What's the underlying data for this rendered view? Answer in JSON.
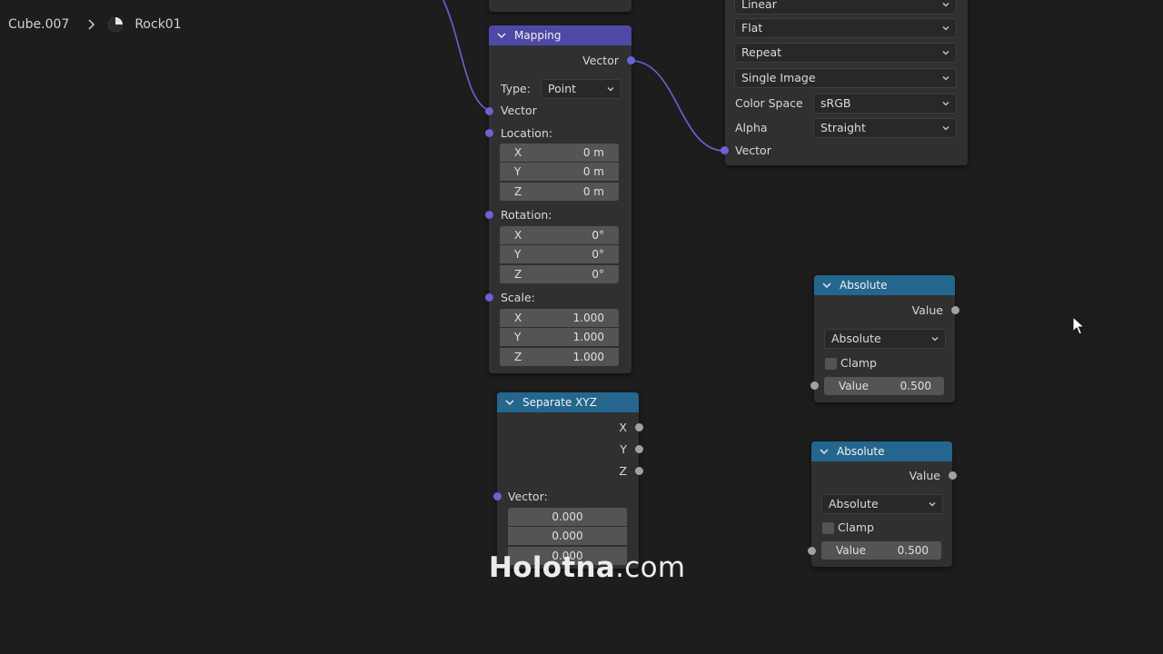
{
  "breadcrumb": {
    "object": "Cube.007",
    "material": "Rock01"
  },
  "image_node": {
    "interpolation": "Linear",
    "projection": "Flat",
    "extension": "Repeat",
    "source": "Single Image",
    "color_space_label": "Color Space",
    "color_space": "sRGB",
    "alpha_label": "Alpha",
    "alpha": "Straight",
    "vector_label": "Vector"
  },
  "mapping_node": {
    "title": "Mapping",
    "output_vector": "Vector",
    "type_label": "Type:",
    "type_value": "Point",
    "input_vector": "Vector",
    "location_label": "Location:",
    "location": [
      {
        "axis": "X",
        "value": "0 m"
      },
      {
        "axis": "Y",
        "value": "0 m"
      },
      {
        "axis": "Z",
        "value": "0 m"
      }
    ],
    "rotation_label": "Rotation:",
    "rotation": [
      {
        "axis": "X",
        "value": "0°"
      },
      {
        "axis": "Y",
        "value": "0°"
      },
      {
        "axis": "Z",
        "value": "0°"
      }
    ],
    "scale_label": "Scale:",
    "scale": [
      {
        "axis": "X",
        "value": "1.000"
      },
      {
        "axis": "Y",
        "value": "1.000"
      },
      {
        "axis": "Z",
        "value": "1.000"
      }
    ]
  },
  "separate_node": {
    "title": "Separate XYZ",
    "outputs": [
      "X",
      "Y",
      "Z"
    ],
    "vector_label": "Vector:",
    "vector_values": [
      "0.000",
      "0.000",
      "0.000"
    ]
  },
  "absolute_nodes": [
    {
      "title": "Absolute",
      "output": "Value",
      "operation": "Absolute",
      "clamp_label": "Clamp",
      "clamp": false,
      "input_label": "Value",
      "input_value": "0.500"
    },
    {
      "title": "Absolute",
      "output": "Value",
      "operation": "Absolute",
      "clamp_label": "Clamp",
      "clamp": false,
      "input_label": "Value",
      "input_value": "0.500"
    }
  ],
  "watermark": {
    "brand": "Holotna",
    "domain": ".com"
  },
  "colors": {
    "vector_header": "#4e49a6",
    "converter_header": "#24668e",
    "vector_socket": "#6a62d6",
    "float_socket": "#a1a1a1",
    "wire": "#6a62d6"
  }
}
